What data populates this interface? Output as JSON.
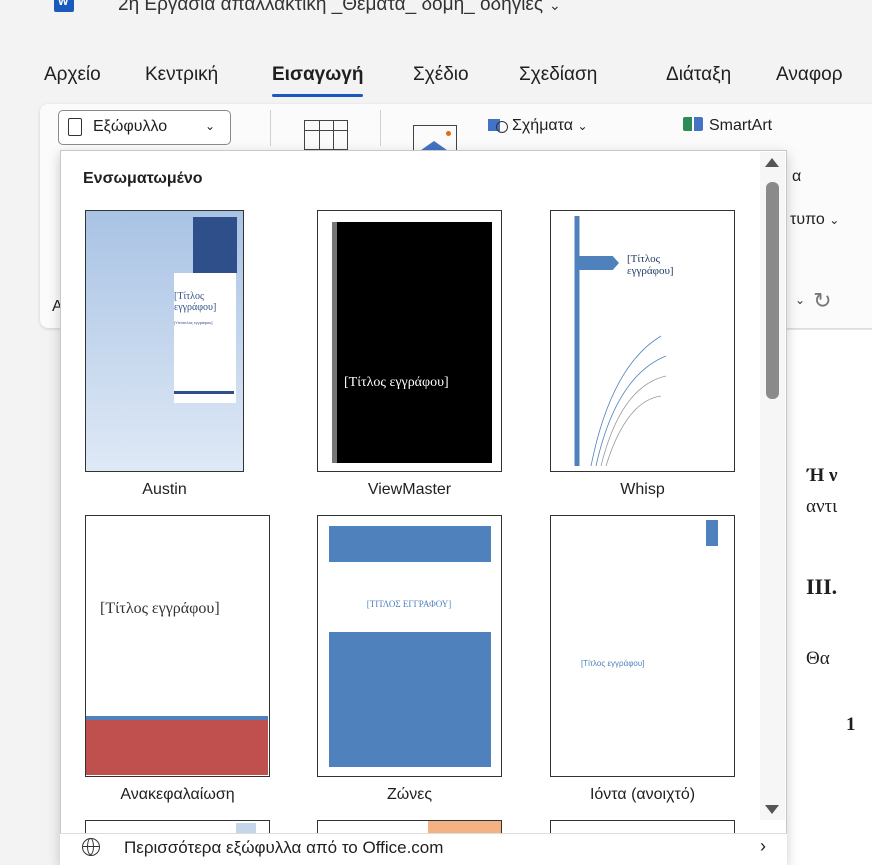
{
  "window": {
    "title": "2η Εργασία απαλλακτική _Θεματα_ δομη_ οδηγιες"
  },
  "tabs": [
    "Αρχείο",
    "Κεντρική",
    "Εισαγωγή",
    "Σχέδιο",
    "Σχεδίαση",
    "Διάταξη",
    "Αναφορ"
  ],
  "active_tab": "Εισαγωγή",
  "ribbon": {
    "cover_page_label": "Εξώφυλλο",
    "shapes_label": "Σχήματα",
    "smartart_label": "SmartArt",
    "partial_1": "α",
    "partial_2": "τυπο",
    "partial_3": "A"
  },
  "gallery": {
    "heading": "Ενσωματωμένο",
    "items": [
      {
        "name": "Austin",
        "title_text": "[Τίτλος εγγράφου]",
        "subtitle_text": "[Υπότιτλος εγγράφου]"
      },
      {
        "name": "ViewMaster",
        "title_text": "[Τίτλος εγγράφου]"
      },
      {
        "name": "Whisp",
        "title_text": "[Τίτλος εγγράφου]"
      },
      {
        "name": "Ανακεφαλαίωση",
        "title_text": "[Τίτλος εγγράφου]"
      },
      {
        "name": "Ζώνες",
        "title_text": "[ΤΙΤΛΟΣ ΕΓΓΡΑΦΟΥ]"
      },
      {
        "name": "Ιόντα (ανοιχτό)",
        "title_text": "[Τίτλος εγγράφου]"
      }
    ],
    "more_link": "Περισσότερα εξώφυλλα από το Office.com"
  },
  "document_partial": {
    "line1": "Ή ν",
    "line2": "αντι",
    "line3": "ΙΙΙ.",
    "line4": "Θα",
    "line5": "1"
  },
  "colors": {
    "accent": "#185abd",
    "austin_blue": "#2e4f8a",
    "zones_blue": "#4f81bd",
    "recap_red": "#c0504d"
  }
}
